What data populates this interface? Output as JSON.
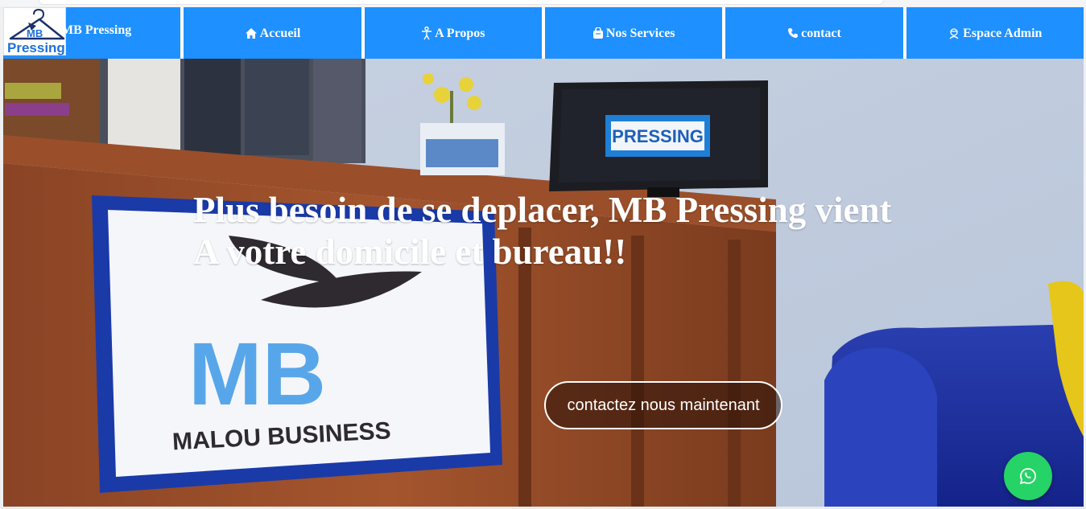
{
  "colors": {
    "nav_bg": "#1e90ff",
    "nav_text": "#ffffff",
    "whatsapp": "#25d366"
  },
  "nav": {
    "brand": {
      "label": "MB Pressing",
      "logo_text": "Pressing",
      "logo_mark": "MB"
    },
    "items": [
      {
        "label": "Accueil",
        "icon": "home-icon"
      },
      {
        "label": "A Propos",
        "icon": "person-icon"
      },
      {
        "label": "Nos Services",
        "icon": "bag-icon"
      },
      {
        "label": "contact",
        "icon": "phone-icon"
      },
      {
        "label": "Espace Admin",
        "icon": "admin-icon"
      }
    ]
  },
  "hero": {
    "title": "Plus besoin de se deplacer, MB Pressing vient A votre domicile et bureau!!",
    "cta_label": "contactez nous maintenant",
    "image_texts": {
      "monitor": "PRESSING",
      "sign_mark": "MB",
      "sign_name": "MALOU BUSINESS"
    }
  },
  "floating": {
    "whatsapp_icon": "whatsapp-icon"
  }
}
